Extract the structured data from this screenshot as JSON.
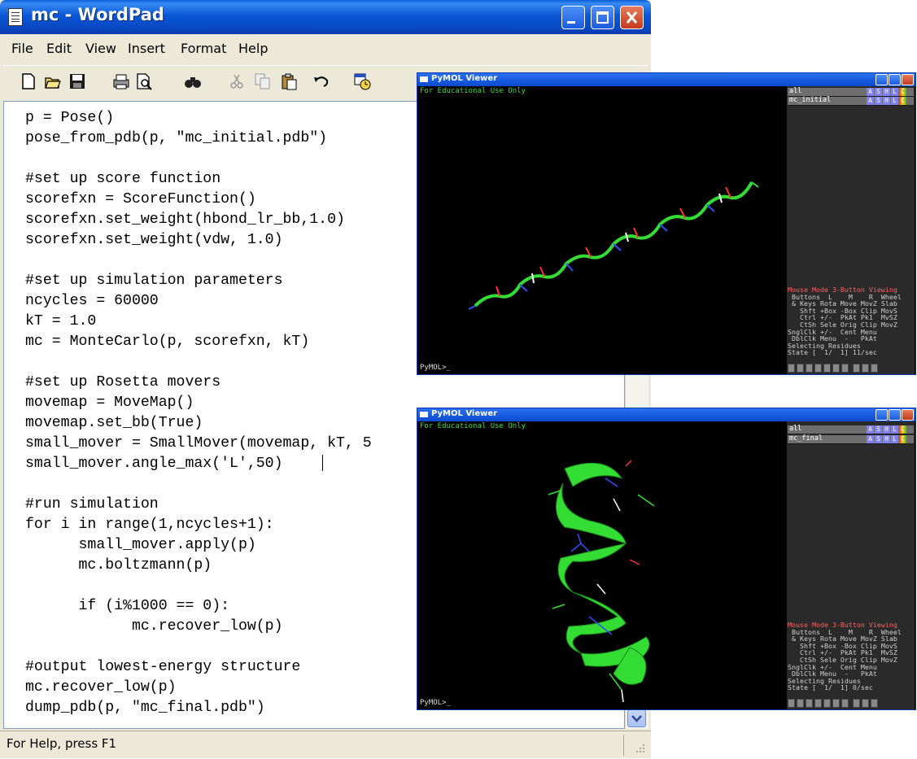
{
  "wordpad": {
    "title": "mc - WordPad",
    "menu": [
      "File",
      "Edit",
      "View",
      "Insert",
      "Format",
      "Help"
    ],
    "toolbar": [
      "new-icon",
      "open-icon",
      "save-icon",
      "print-icon",
      "print-preview-icon",
      "find-icon",
      "cut-icon",
      "copy-icon",
      "paste-icon",
      "undo-icon",
      "datetime-icon"
    ],
    "code": "p = Pose()\npose_from_pdb(p, \"mc_initial.pdb\")\n\n#set up score function\nscorefxn = ScoreFunction()\nscorefxn.set_weight(hbond_lr_bb,1.0)\nscorefxn.set_weight(vdw, 1.0)\n\n#set up simulation parameters\nncycles = 60000\nkT = 1.0\nmc = MonteCarlo(p, scorefxn, kT)\n\n#set up Rosetta movers\nmovemap = MoveMap()\nmovemap.set_bb(True)\nsmall_mover = SmallMover(movemap, kT, 5\nsmall_mover.angle_max('L',50)\n\n#run simulation\nfor i in range(1,ncycles+1):\n      small_mover.apply(p)\n      mc.boltzmann(p)\n\n      if (i%1000 == 0):\n            mc.recover_low(p)\n\n#output lowest-energy structure\nmc.recover_low(p)\ndump_pdb(p, \"mc_final.pdb\")",
    "status": "For Help, press F1"
  },
  "pymol_top": {
    "title": "PyMOL Viewer",
    "edu": "For Educational Use Only",
    "prompt": "PyMOL>_",
    "objects": [
      "all",
      "mc_initial"
    ],
    "buttons": [
      "A",
      "S",
      "H",
      "L",
      "C"
    ],
    "mouse_text": "Mouse Mode 3-Button Viewing\n Buttons  L    M    R  Wheel\n & Keys Rota Move MovZ Slab\n   Shft +Box -Box Clip MovS\n   Ctrl +/-  PkAt Pk1  MvSZ\n   CtSh Sele Orig Clip MovZ\nSnglClk +/-  Cent Menu\n DblClk Menu  -   PkAt\nSelecting Residues\nState [  1/  1] 11/sec"
  },
  "pymol_bottom": {
    "title": "PyMOL Viewer",
    "edu": "For Educational Use Only",
    "prompt": "PyMOL>_",
    "objects": [
      "all",
      "mc_final"
    ],
    "buttons": [
      "A",
      "S",
      "H",
      "L",
      "C"
    ],
    "mouse_text": "Mouse Mode 3-Button Viewing\n Buttons  L    M    R  Wheel\n & Keys Rota Move MovZ Slab\n   Shft +Box -Box Clip MovS\n   Ctrl +/-  PkAt Pk1  MvSZ\n   CtSh Sele Orig Clip MovZ\nSnglClk +/-  Cent Menu\n DblClk Menu  -   PkAt\nSelecting Residues\nState [  1/  1] 0/sec"
  },
  "colors": {
    "helix": "#33dd33",
    "edu_text": "#3cdc3c",
    "button_bg": "#8080ff"
  }
}
